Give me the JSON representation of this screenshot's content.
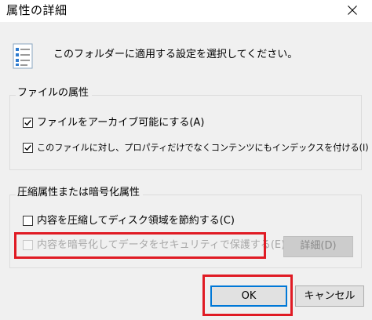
{
  "dialog": {
    "title": "属性の詳細",
    "close_icon": "close-icon"
  },
  "header": {
    "icon": "properties-list-icon",
    "instruction": "このフォルダーに適用する設定を選択してください。"
  },
  "file_attributes": {
    "group_label": "ファイルの属性",
    "archive": {
      "label": "ファイルをアーカイブ可能にする(A)",
      "checked": true
    },
    "index": {
      "label": "このファイルに対し、プロパティだけでなくコンテンツにもインデックスを付ける(I)",
      "checked": true
    }
  },
  "compress_encrypt": {
    "group_label": "圧縮属性または暗号化属性",
    "compress": {
      "label": "内容を圧縮してディスク領域を節約する(C)",
      "checked": false
    },
    "encrypt": {
      "label": "内容を暗号化してデータをセキュリティで保護する(E)",
      "checked": false,
      "enabled": false
    },
    "details_button": "詳細(D)"
  },
  "buttons": {
    "ok": "OK",
    "cancel": "キャンセル"
  },
  "colors": {
    "highlight": "#e01b24",
    "focus": "#0078d7"
  }
}
